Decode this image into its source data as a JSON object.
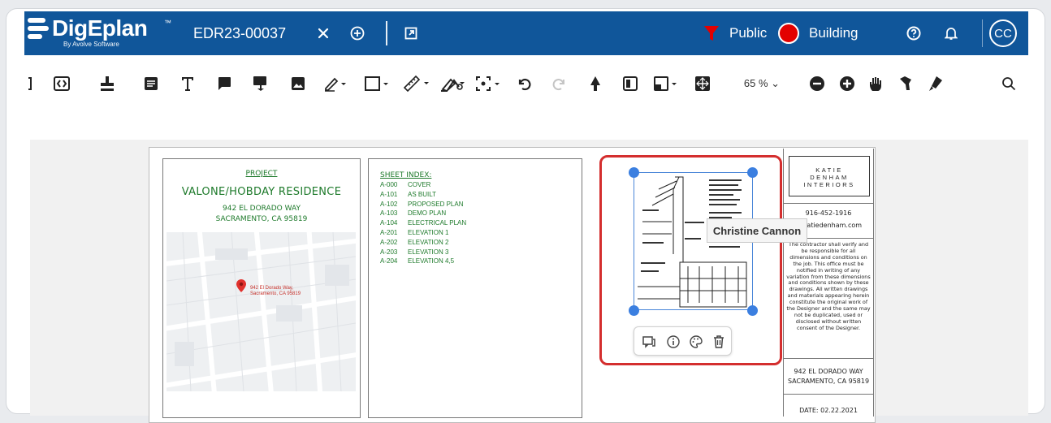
{
  "app": {
    "name": "DigEplan",
    "tm": "™",
    "subtitle": "By Avolve Software"
  },
  "header": {
    "document_id": "EDR23-00037",
    "close_icon": "close-icon",
    "add_icon": "add-circle-icon",
    "external_icon": "open-external-icon",
    "visibility_label": "Public",
    "discipline_label": "Building",
    "avatar_initials": "CC",
    "colors": {
      "bar": "#10569a",
      "filter": "#e30000",
      "status": "#e30000"
    }
  },
  "toolbar": {
    "zoom_label": "65 % ⌄"
  },
  "sheet": {
    "project": {
      "label": "PROJECT",
      "name": "VALONE/HOBDAY RESIDENCE",
      "address_line1": "942 EL DORADO WAY",
      "address_line2": "SACRAMENTO, CA 95819",
      "map_pin_line1": "942 El Dorado Way,",
      "map_pin_line2": "Sacramento, CA 95819"
    },
    "sheet_index": {
      "title": "SHEET INDEX:",
      "rows": [
        {
          "code": "A-000",
          "name": "COVER"
        },
        {
          "code": "A-101",
          "name": "AS BUILT"
        },
        {
          "code": "A-102",
          "name": "PROPOSED PLAN"
        },
        {
          "code": "A-103",
          "name": "DEMO PLAN"
        },
        {
          "code": "A-104",
          "name": "ELECTRICAL PLAN"
        },
        {
          "code": "A-201",
          "name": "ELEVATION 1"
        },
        {
          "code": "A-202",
          "name": "ELEVATION 2"
        },
        {
          "code": "A-203",
          "name": "ELEVATION 3"
        },
        {
          "code": "A-204",
          "name": "ELEVATION 4,5"
        }
      ]
    },
    "title_block": {
      "firm_line1": "KATIE",
      "firm_line2": "DENHAM",
      "firm_line3": "INTERIORS",
      "phone": "916-452-1916",
      "website": "katiedenham.com",
      "note": "The contractor shall verify and be responsible for all dimensions and conditions on the job. This office must be notified in writing of any variation from these dimensions and conditions shown by these drawings. All written drawings and materials appearing herein constitute the original work of the Designer and the same may not be duplicated, used or disclosed without written consent of the Designer.",
      "address_line1": "942 EL DORADO WAY",
      "address_line2": "SACRAMENTO, CA 95819",
      "date": "DATE: 02.22.2021"
    }
  },
  "selection": {
    "tooltip": "Christine Cannon",
    "actions": [
      "comment-icon",
      "info-icon",
      "palette-icon",
      "trash-icon"
    ]
  }
}
